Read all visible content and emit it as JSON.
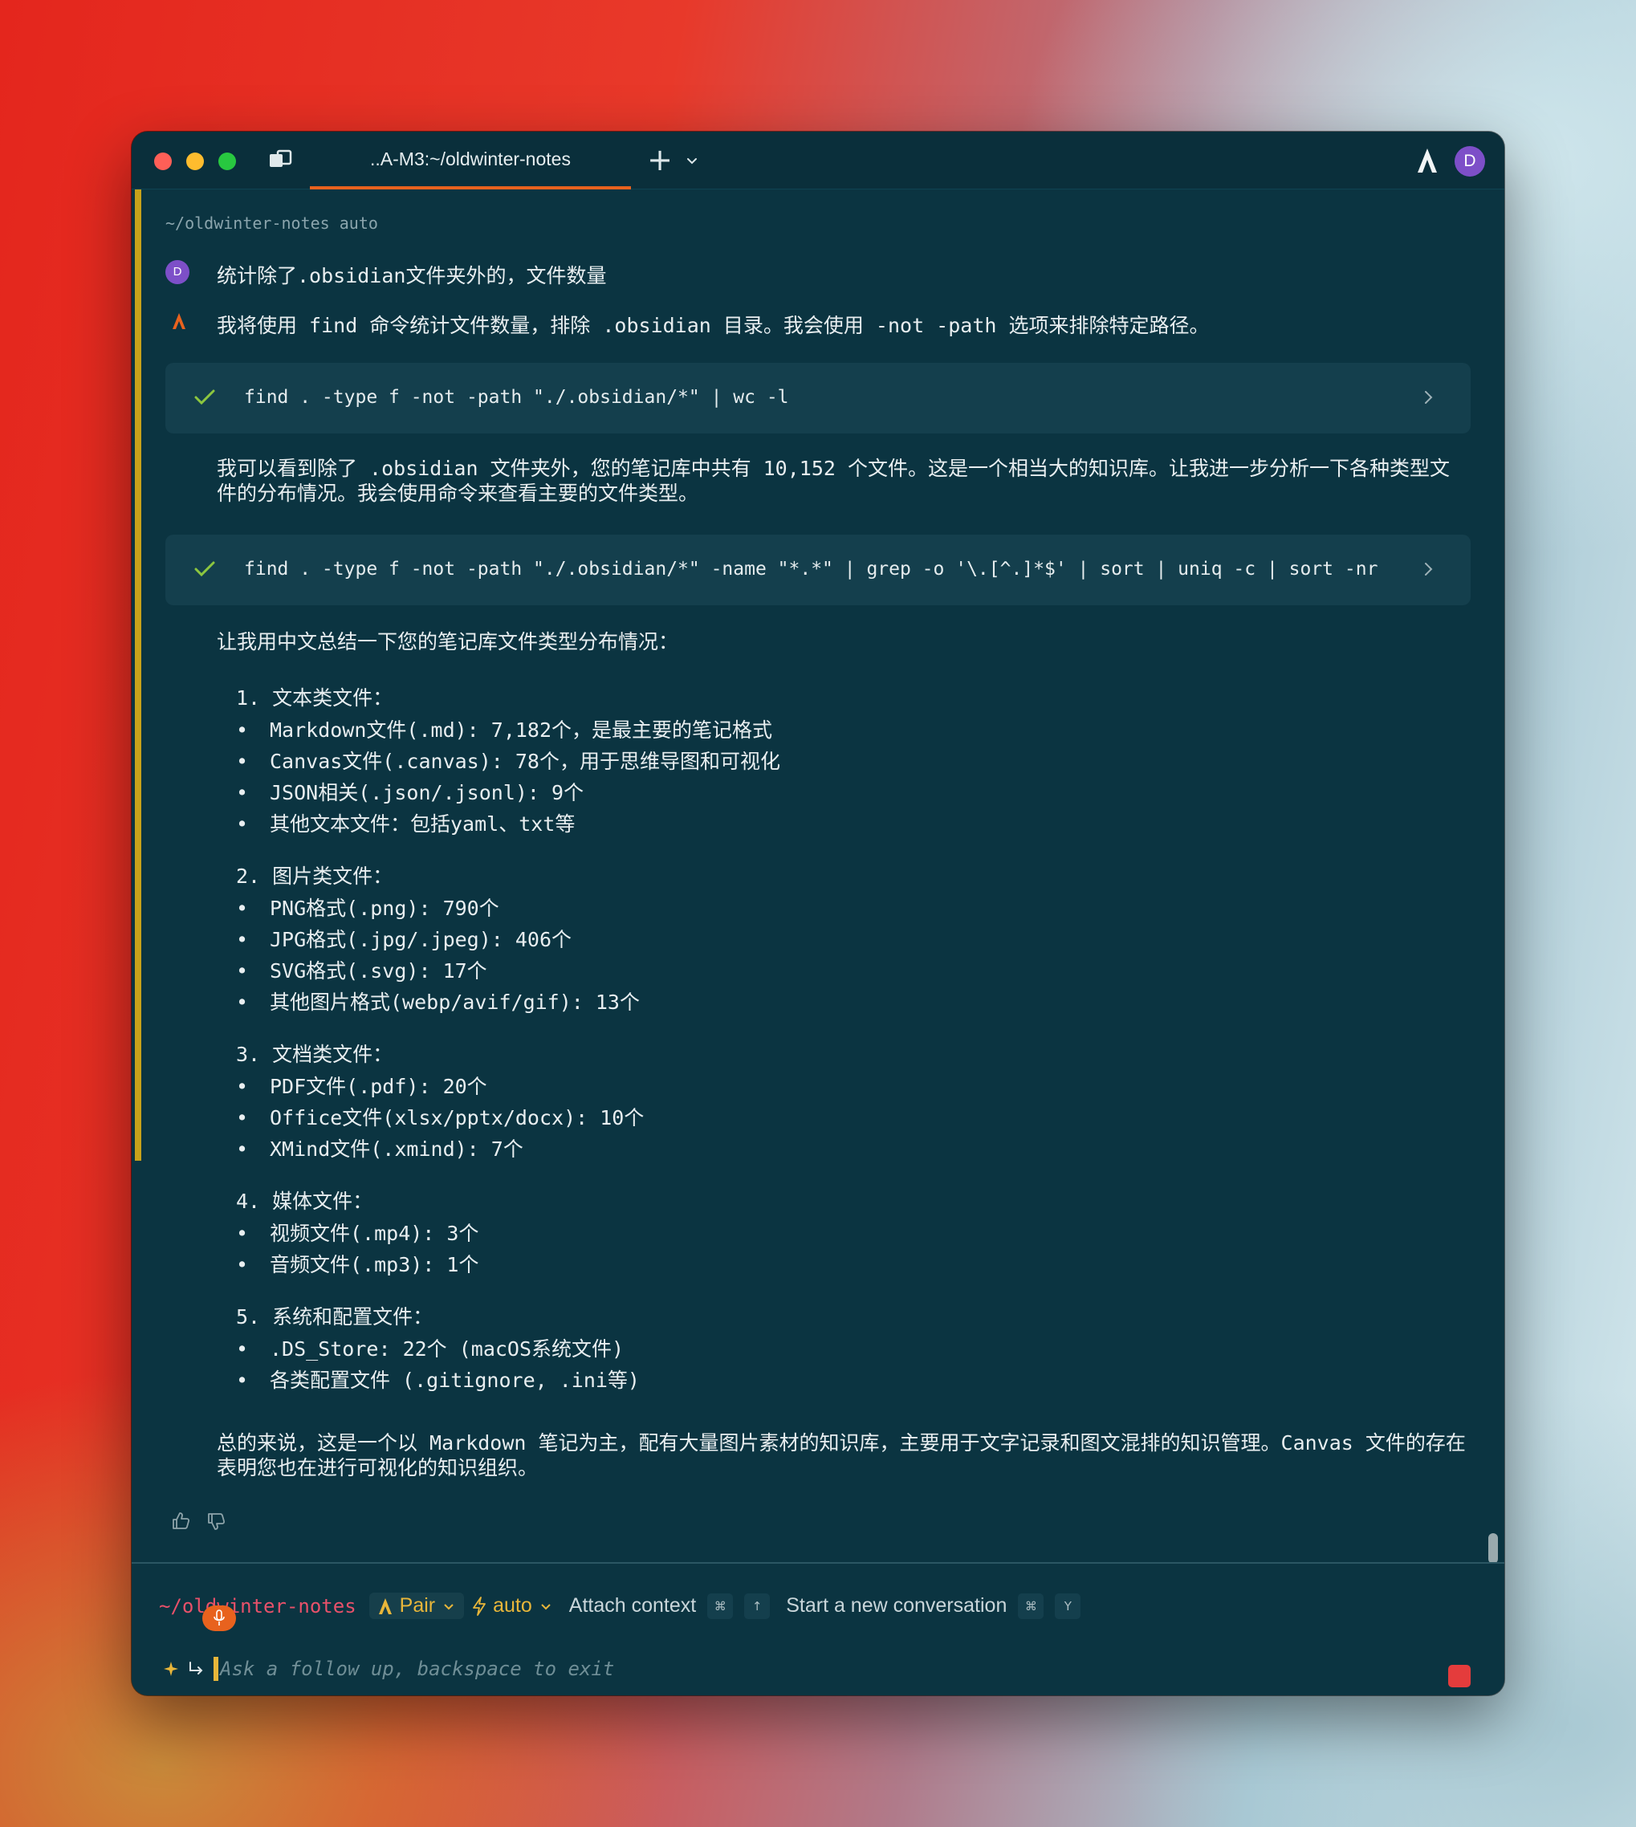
{
  "titlebar": {
    "tab_title": "..A-M3:~/oldwinter-notes",
    "new_tab_label": "+",
    "avatar_initial": "D"
  },
  "session": {
    "cwd_line": "~/oldwinter-notes auto"
  },
  "user_message": {
    "avatar_initial": "D",
    "text": "统计除了.obsidian文件夹外的，文件数量"
  },
  "assistant": {
    "intro": "我将使用 find 命令统计文件数量，排除 .obsidian 目录。我会使用 -not -path 选项来排除特定路径。",
    "command_1": "find . -type f -not -path \"./.obsidian/*\" | wc -l",
    "result_1": "我可以看到除了 .obsidian 文件夹外，您的笔记库中共有 10,152 个文件。这是一个相当大的知识库。让我进一步分析一下各种类型文件的分布情况。我会使用命令来查看主要的文件类型。",
    "command_2": "find . -type f -not -path \"./.obsidian/*\" -name \"*.*\" | grep -o '\\.[^.]*$' | sort | uniq -c | sort -nr",
    "summary_intro": "让我用中文总结一下您的笔记库文件类型分布情况：",
    "sections": [
      {
        "title": "1. 文本类文件：",
        "items": [
          "Markdown文件(.md): 7,182个，是最主要的笔记格式",
          "Canvas文件(.canvas): 78个，用于思维导图和可视化",
          "JSON相关(.json/.jsonl): 9个",
          "其他文本文件：包括yaml、txt等"
        ]
      },
      {
        "title": "2. 图片类文件：",
        "items": [
          "PNG格式(.png): 790个",
          "JPG格式(.jpg/.jpeg): 406个",
          "SVG格式(.svg): 17个",
          "其他图片格式(webp/avif/gif): 13个"
        ]
      },
      {
        "title": "3. 文档类文件：",
        "items": [
          "PDF文件(.pdf): 20个",
          "Office文件(xlsx/pptx/docx): 10个",
          "XMind文件(.xmind): 7个"
        ]
      },
      {
        "title": "4. 媒体文件：",
        "items": [
          "视频文件(.mp4): 3个",
          "音频文件(.mp3): 1个"
        ]
      },
      {
        "title": "5. 系统和配置文件：",
        "items": [
          ".DS_Store: 22个 (macOS系统文件)",
          "各类配置文件 (.gitignore, .ini等)"
        ]
      }
    ],
    "conclusion": "总的来说，这是一个以 Markdown 笔记为主，配有大量图片素材的知识库，主要用于文字记录和图文混排的知识管理。Canvas 文件的存在表明您也在进行可视化的知识组织。",
    "bullet_char": "•"
  },
  "input_bar": {
    "path": "~/oldwinter-notes",
    "mode": "Pair",
    "model": "auto",
    "attach_label": "Attach context",
    "attach_kbd_1": "⌘",
    "attach_kbd_2": "↑",
    "new_conv_label": "Start a new conversation",
    "new_conv_kbd_1": "⌘",
    "new_conv_kbd_2": "Y",
    "placeholder": "Ask a follow up, backspace to exit"
  },
  "colors": {
    "window_bg": "#0b3441",
    "accent_tab": "#e8621e",
    "left_bar": "#c8a21a",
    "check_green": "#8cc63f",
    "path_red": "#e8516a",
    "chip_yellow": "#e8b63a",
    "stop_red": "#e43c3c",
    "avatar_purple": "#7d4fc8"
  },
  "icons": [
    "panes-icon",
    "plus-icon",
    "chevron-down-icon",
    "warp-logo-icon",
    "check-icon",
    "chevron-right-icon",
    "thumbs-up-icon",
    "thumbs-down-icon",
    "sparkle-icon",
    "return-arrow-icon",
    "microphone-icon",
    "stop-icon"
  ]
}
